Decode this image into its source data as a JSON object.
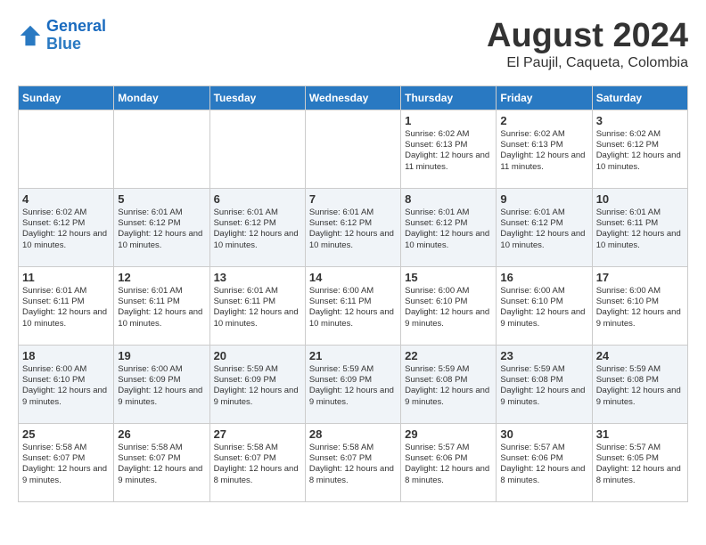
{
  "logo": {
    "line1": "General",
    "line2": "Blue"
  },
  "title": "August 2024",
  "subtitle": "El Paujil, Caqueta, Colombia",
  "weekdays": [
    "Sunday",
    "Monday",
    "Tuesday",
    "Wednesday",
    "Thursday",
    "Friday",
    "Saturday"
  ],
  "weeks": [
    [
      {
        "day": "",
        "content": ""
      },
      {
        "day": "",
        "content": ""
      },
      {
        "day": "",
        "content": ""
      },
      {
        "day": "",
        "content": ""
      },
      {
        "day": "1",
        "content": "Sunrise: 6:02 AM\nSunset: 6:13 PM\nDaylight: 12 hours and 11 minutes."
      },
      {
        "day": "2",
        "content": "Sunrise: 6:02 AM\nSunset: 6:13 PM\nDaylight: 12 hours and 11 minutes."
      },
      {
        "day": "3",
        "content": "Sunrise: 6:02 AM\nSunset: 6:12 PM\nDaylight: 12 hours and 10 minutes."
      }
    ],
    [
      {
        "day": "4",
        "content": "Sunrise: 6:02 AM\nSunset: 6:12 PM\nDaylight: 12 hours and 10 minutes."
      },
      {
        "day": "5",
        "content": "Sunrise: 6:01 AM\nSunset: 6:12 PM\nDaylight: 12 hours and 10 minutes."
      },
      {
        "day": "6",
        "content": "Sunrise: 6:01 AM\nSunset: 6:12 PM\nDaylight: 12 hours and 10 minutes."
      },
      {
        "day": "7",
        "content": "Sunrise: 6:01 AM\nSunset: 6:12 PM\nDaylight: 12 hours and 10 minutes."
      },
      {
        "day": "8",
        "content": "Sunrise: 6:01 AM\nSunset: 6:12 PM\nDaylight: 12 hours and 10 minutes."
      },
      {
        "day": "9",
        "content": "Sunrise: 6:01 AM\nSunset: 6:12 PM\nDaylight: 12 hours and 10 minutes."
      },
      {
        "day": "10",
        "content": "Sunrise: 6:01 AM\nSunset: 6:11 PM\nDaylight: 12 hours and 10 minutes."
      }
    ],
    [
      {
        "day": "11",
        "content": "Sunrise: 6:01 AM\nSunset: 6:11 PM\nDaylight: 12 hours and 10 minutes."
      },
      {
        "day": "12",
        "content": "Sunrise: 6:01 AM\nSunset: 6:11 PM\nDaylight: 12 hours and 10 minutes."
      },
      {
        "day": "13",
        "content": "Sunrise: 6:01 AM\nSunset: 6:11 PM\nDaylight: 12 hours and 10 minutes."
      },
      {
        "day": "14",
        "content": "Sunrise: 6:00 AM\nSunset: 6:11 PM\nDaylight: 12 hours and 10 minutes."
      },
      {
        "day": "15",
        "content": "Sunrise: 6:00 AM\nSunset: 6:10 PM\nDaylight: 12 hours and 9 minutes."
      },
      {
        "day": "16",
        "content": "Sunrise: 6:00 AM\nSunset: 6:10 PM\nDaylight: 12 hours and 9 minutes."
      },
      {
        "day": "17",
        "content": "Sunrise: 6:00 AM\nSunset: 6:10 PM\nDaylight: 12 hours and 9 minutes."
      }
    ],
    [
      {
        "day": "18",
        "content": "Sunrise: 6:00 AM\nSunset: 6:10 PM\nDaylight: 12 hours and 9 minutes."
      },
      {
        "day": "19",
        "content": "Sunrise: 6:00 AM\nSunset: 6:09 PM\nDaylight: 12 hours and 9 minutes."
      },
      {
        "day": "20",
        "content": "Sunrise: 5:59 AM\nSunset: 6:09 PM\nDaylight: 12 hours and 9 minutes."
      },
      {
        "day": "21",
        "content": "Sunrise: 5:59 AM\nSunset: 6:09 PM\nDaylight: 12 hours and 9 minutes."
      },
      {
        "day": "22",
        "content": "Sunrise: 5:59 AM\nSunset: 6:08 PM\nDaylight: 12 hours and 9 minutes."
      },
      {
        "day": "23",
        "content": "Sunrise: 5:59 AM\nSunset: 6:08 PM\nDaylight: 12 hours and 9 minutes."
      },
      {
        "day": "24",
        "content": "Sunrise: 5:59 AM\nSunset: 6:08 PM\nDaylight: 12 hours and 9 minutes."
      }
    ],
    [
      {
        "day": "25",
        "content": "Sunrise: 5:58 AM\nSunset: 6:07 PM\nDaylight: 12 hours and 9 minutes."
      },
      {
        "day": "26",
        "content": "Sunrise: 5:58 AM\nSunset: 6:07 PM\nDaylight: 12 hours and 9 minutes."
      },
      {
        "day": "27",
        "content": "Sunrise: 5:58 AM\nSunset: 6:07 PM\nDaylight: 12 hours and 8 minutes."
      },
      {
        "day": "28",
        "content": "Sunrise: 5:58 AM\nSunset: 6:07 PM\nDaylight: 12 hours and 8 minutes."
      },
      {
        "day": "29",
        "content": "Sunrise: 5:57 AM\nSunset: 6:06 PM\nDaylight: 12 hours and 8 minutes."
      },
      {
        "day": "30",
        "content": "Sunrise: 5:57 AM\nSunset: 6:06 PM\nDaylight: 12 hours and 8 minutes."
      },
      {
        "day": "31",
        "content": "Sunrise: 5:57 AM\nSunset: 6:05 PM\nDaylight: 12 hours and 8 minutes."
      }
    ]
  ]
}
